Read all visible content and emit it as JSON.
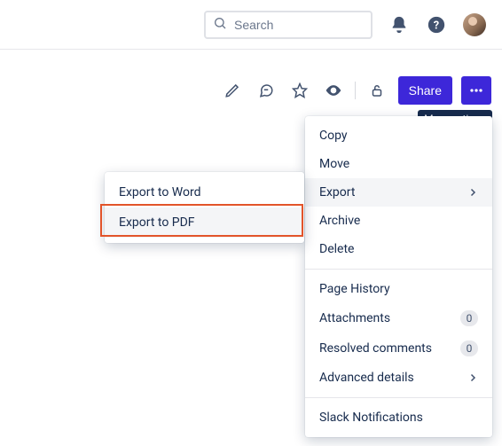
{
  "header": {
    "search_placeholder": "Search"
  },
  "toolbar": {
    "share_label": "Share",
    "more_tooltip": "More actions"
  },
  "menu": {
    "copy": "Copy",
    "move": "Move",
    "export": "Export",
    "archive": "Archive",
    "delete": "Delete",
    "page_history": "Page History",
    "attachments": "Attachments",
    "attachments_count": "0",
    "resolved_comments": "Resolved comments",
    "resolved_count": "0",
    "advanced_details": "Advanced details",
    "slack": "Slack Notifications"
  },
  "submenu": {
    "word": "Export to Word",
    "pdf": "Export to PDF"
  }
}
